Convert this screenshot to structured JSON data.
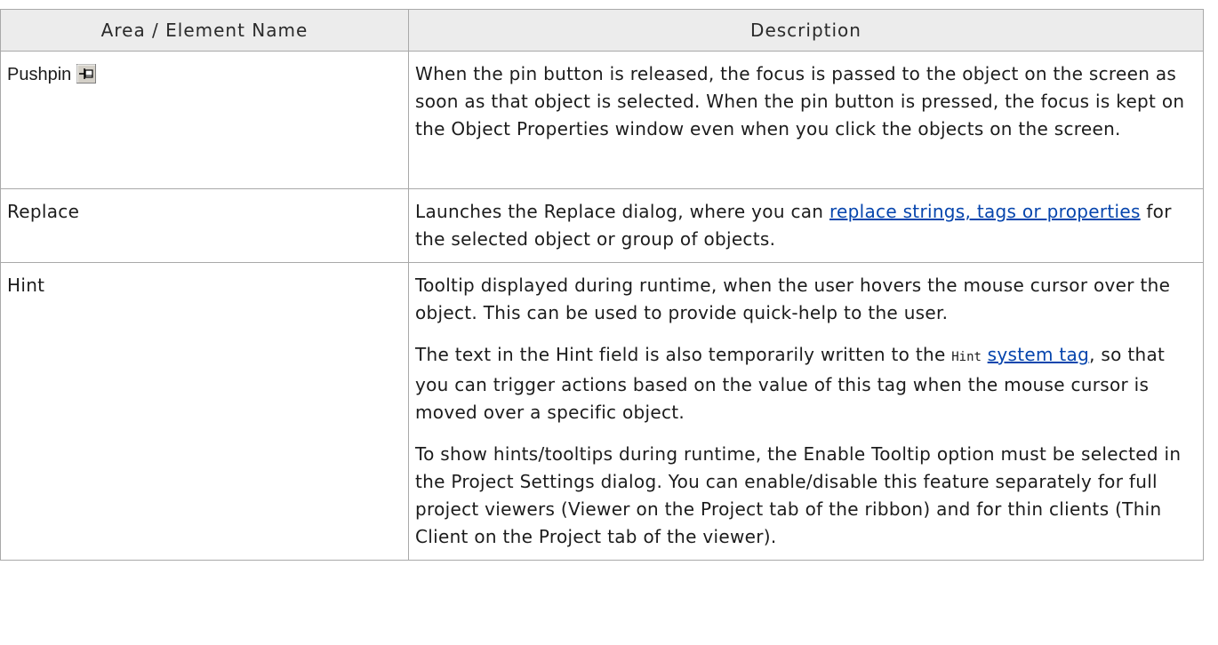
{
  "table": {
    "headers": {
      "name": "Area / Element Name",
      "description": "Description"
    },
    "rows": {
      "pushpin": {
        "name": "Pushpin",
        "icon": "pushpin-icon",
        "description": "When the pin button is released, the focus is passed to the object on the screen as soon as that object is selected. When the pin button is pressed, the focus is kept on the Object Properties window even when you click the objects on the screen."
      },
      "replace": {
        "name": "Replace",
        "desc_before": "Launches the Replace dialog, where you can ",
        "link": "replace strings, tags or properties",
        "desc_after": " for the selected object or group of objects."
      },
      "hint": {
        "name": "Hint",
        "para1": "Tooltip displayed during runtime, when the user hovers the mouse cursor over the object. This can be used to provide quick-help to the user.",
        "para2_before": "The text in the Hint field is also temporarily written to the ",
        "para2_code": "Hint",
        "para2_link": "system tag",
        "para2_after": ", so that you can trigger actions based on the value of this tag when the mouse cursor is moved over a specific object.",
        "para3": "To show hints/tooltips during runtime, the Enable Tooltip option must be selected in the Project Settings dialog. You can enable/disable this feature separately for full project viewers (Viewer on the Project tab of the ribbon) and for thin clients (Thin Client on the Project tab of the viewer)."
      }
    }
  },
  "colors": {
    "link": "#0645ad",
    "header_bg": "#ececec",
    "border": "#a9a9a9"
  }
}
